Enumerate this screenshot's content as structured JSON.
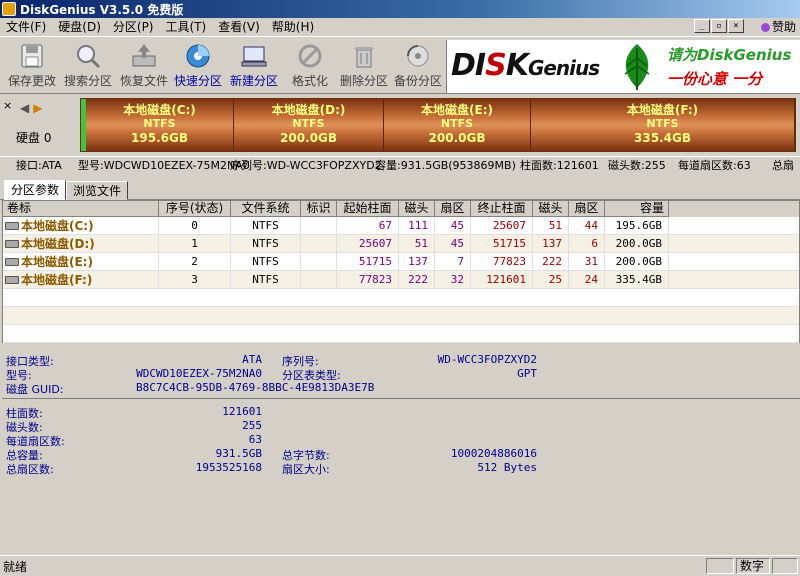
{
  "window": {
    "title": "DiskGenius V3.5.0 免费版"
  },
  "menu": [
    "文件(F)",
    "硬盘(D)",
    "分区(P)",
    "工具(T)",
    "查看(V)",
    "帮助(H)"
  ],
  "help_link": "赞助",
  "toolbar": [
    {
      "label": "保存更改",
      "icon": "save-icon"
    },
    {
      "label": "搜索分区",
      "icon": "search-icon"
    },
    {
      "label": "恢复文件",
      "icon": "recover-icon"
    },
    {
      "label": "快速分区",
      "icon": "quick-partition-icon"
    },
    {
      "label": "新建分区",
      "icon": "new-partition-icon"
    },
    {
      "label": "格式化",
      "icon": "format-icon"
    },
    {
      "label": "删除分区",
      "icon": "delete-icon"
    },
    {
      "label": "备份分区",
      "icon": "backup-icon"
    }
  ],
  "banner": {
    "brand_di": "DI",
    "brand_s": "S",
    "brand_k": "K",
    "brand_genius": "Genius",
    "slogan1": "请为DiskGenius",
    "slogan2": "一份心意  一分"
  },
  "disk": {
    "label": "硬盘 0",
    "partitions": [
      {
        "name": "本地磁盘(C:)",
        "fs": "NTFS",
        "size": "195.6GB"
      },
      {
        "name": "本地磁盘(D:)",
        "fs": "NTFS",
        "size": "200.0GB"
      },
      {
        "name": "本地磁盘(E:)",
        "fs": "NTFS",
        "size": "200.0GB"
      },
      {
        "name": "本地磁盘(F:)",
        "fs": "NTFS",
        "size": "335.4GB"
      }
    ],
    "info": {
      "interface": "接口:ATA",
      "model": "型号:WDCWD10EZEX-75M2NA0",
      "serial": "序列号:WD-WCC3FOPZXYD2",
      "capacity": "容量:931.5GB(953869MB)",
      "cylinders": "柱面数:121601",
      "heads": "磁头数:255",
      "sectors": "每道扇区数:63",
      "total": "总扇"
    }
  },
  "tabs": [
    "分区参数",
    "浏览文件"
  ],
  "table": {
    "headers": [
      "卷标",
      "序号(状态)",
      "文件系统",
      "标识",
      "起始柱面",
      "磁头",
      "扇区",
      "终止柱面",
      "磁头",
      "扇区",
      "容量"
    ],
    "rows": [
      [
        "本地磁盘(C:)",
        "0",
        "NTFS",
        "",
        "67",
        "111",
        "45",
        "25607",
        "51",
        "44",
        "195.6GB"
      ],
      [
        "本地磁盘(D:)",
        "1",
        "NTFS",
        "",
        "25607",
        "51",
        "45",
        "51715",
        "137",
        "6",
        "200.0GB"
      ],
      [
        "本地磁盘(E:)",
        "2",
        "NTFS",
        "",
        "51715",
        "137",
        "7",
        "77823",
        "222",
        "31",
        "200.0GB"
      ],
      [
        "本地磁盘(F:)",
        "3",
        "NTFS",
        "",
        "77823",
        "222",
        "32",
        "121601",
        "25",
        "24",
        "335.4GB"
      ]
    ]
  },
  "details": {
    "interface_type_label": "接口类型:",
    "interface_type": "ATA",
    "serial_label": "序列号:",
    "serial": "WD-WCC3FOPZXYD2",
    "model_label": "型号:",
    "model": "WDCWD10EZEX-75M2NA0",
    "table_type_label": "分区表类型:",
    "table_type": "GPT",
    "guid_label": "磁盘 GUID:",
    "guid": "B8C7C4CB-95DB-4769-8BBC-4E9813DA3E7B",
    "cylinders_label": "柱面数:",
    "cylinders": "121601",
    "heads_label": "磁头数:",
    "heads": "255",
    "sectors_label": "每道扇区数:",
    "sectors": "63",
    "capacity_label": "总容量:",
    "capacity": "931.5GB",
    "total_bytes_label": "总字节数:",
    "total_bytes": "1000204886016",
    "total_sectors_label": "总扇区数:",
    "total_sectors": "1953525168",
    "sector_size_label": "扇区大小:",
    "sector_size": "512 Bytes"
  },
  "status": {
    "text": "就绪",
    "ime": "数字"
  }
}
